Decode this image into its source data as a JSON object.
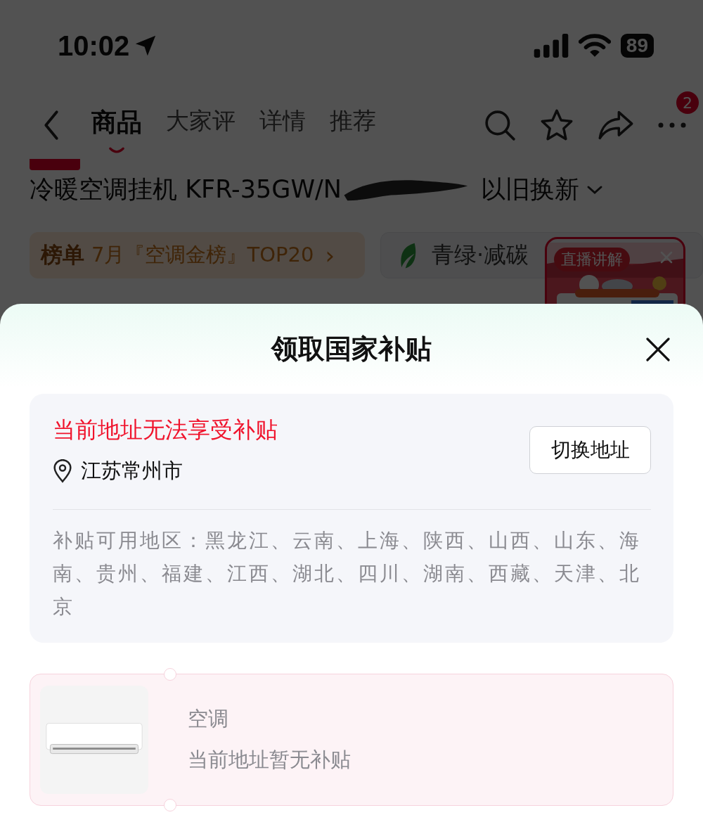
{
  "status_bar": {
    "time": "10:02",
    "battery": "89"
  },
  "nav": {
    "tabs": [
      {
        "label": "商品",
        "selected": true
      },
      {
        "label": "大家评",
        "selected": false
      },
      {
        "label": "详情",
        "selected": false
      },
      {
        "label": "推荐",
        "selected": false
      }
    ],
    "more_badge": "2"
  },
  "product": {
    "title": "冷暖空调挂机 KFR-35GW/N",
    "title_tail": "以旧换新"
  },
  "chips": [
    {
      "kind": "ranking",
      "tag": "榜单",
      "text": "7月『空调金榜』TOP20",
      "arrow": "›"
    },
    {
      "kind": "green",
      "text": "青绿·减碳"
    }
  ],
  "live": {
    "label": "直播讲解"
  },
  "sheet": {
    "title": "领取国家补贴",
    "notice": "当前地址无法享受补贴",
    "location": "江苏常州市",
    "switch_button": "切换地址",
    "regions_text": "补贴可用地区：黑龙江、云南、上海、陕西、山西、山东、海南、贵州、福建、江西、湖北、四川、湖南、西藏、天津、北京",
    "items": [
      {
        "name": "空调",
        "status": "当前地址暂无补贴"
      }
    ]
  }
}
